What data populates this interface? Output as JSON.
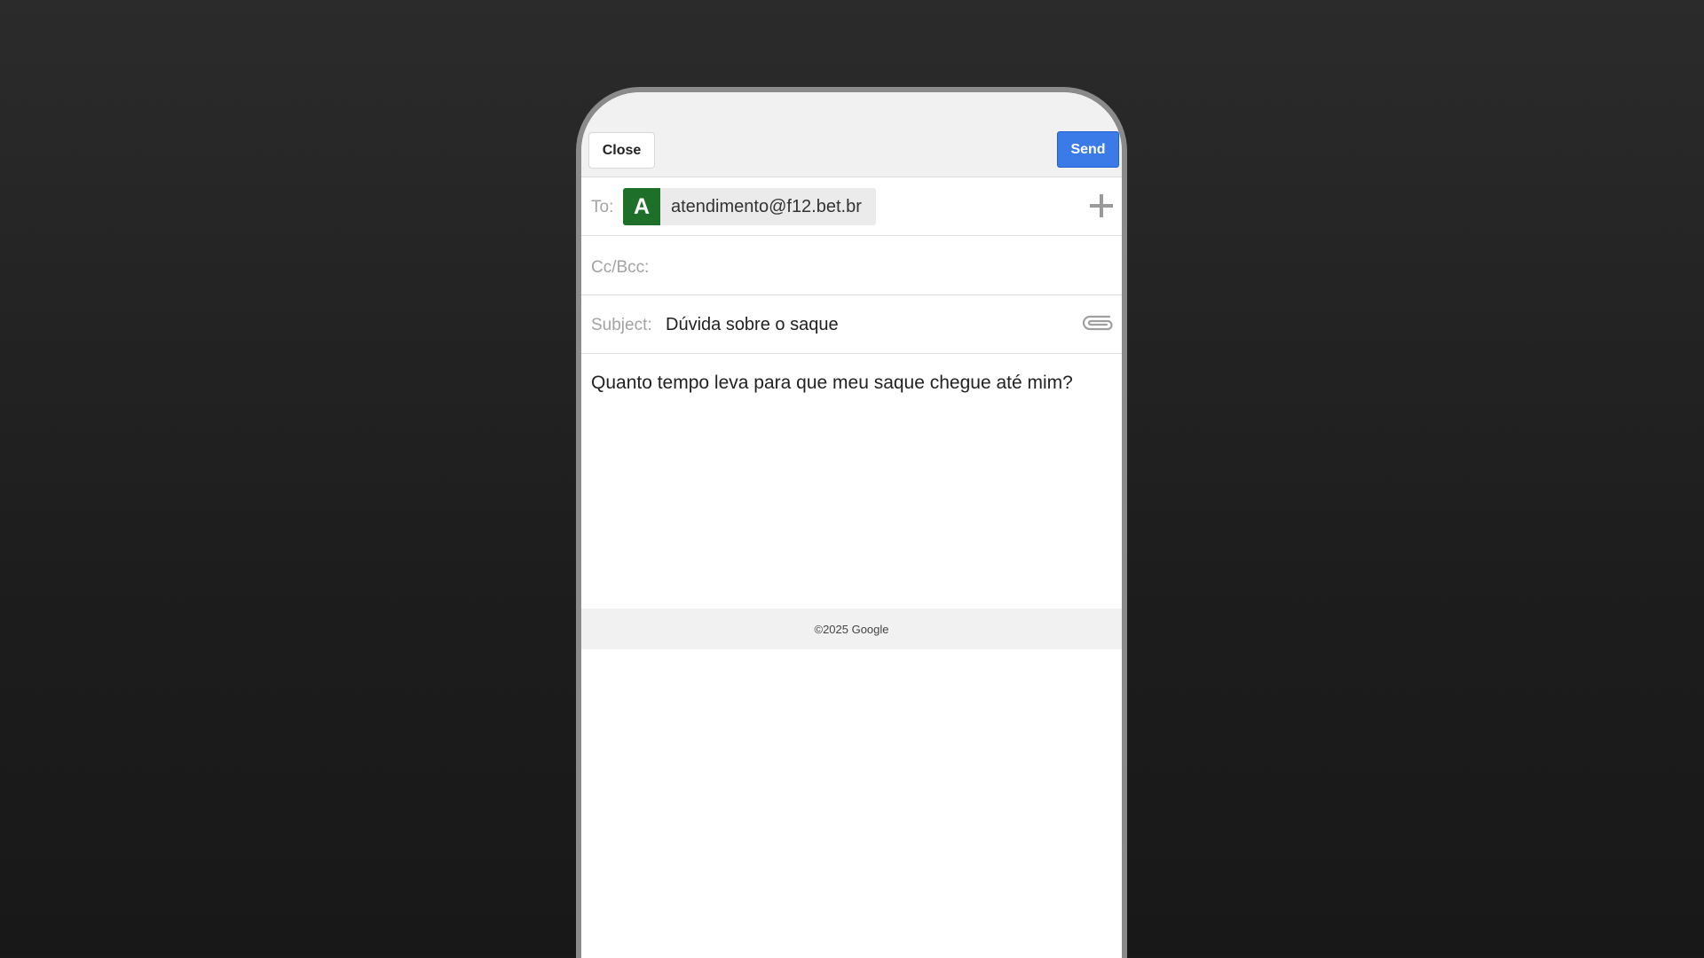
{
  "header": {
    "close_label": "Close",
    "send_label": "Send"
  },
  "to": {
    "label": "To:",
    "recipient_initial": "A",
    "recipient_email": "atendimento@f12.bet.br",
    "add_icon": "plus-icon"
  },
  "cc": {
    "label": "Cc/Bcc:"
  },
  "subject": {
    "label": "Subject:",
    "value": "Dúvida sobre o saque",
    "attach_icon": "paperclip-icon"
  },
  "body": {
    "text": "Quanto tempo leva para que meu saque chegue até mim?"
  },
  "footer": {
    "text": "©2025 Google"
  },
  "colors": {
    "send_button": "#3b7be8",
    "avatar": "#1e6f2a"
  }
}
